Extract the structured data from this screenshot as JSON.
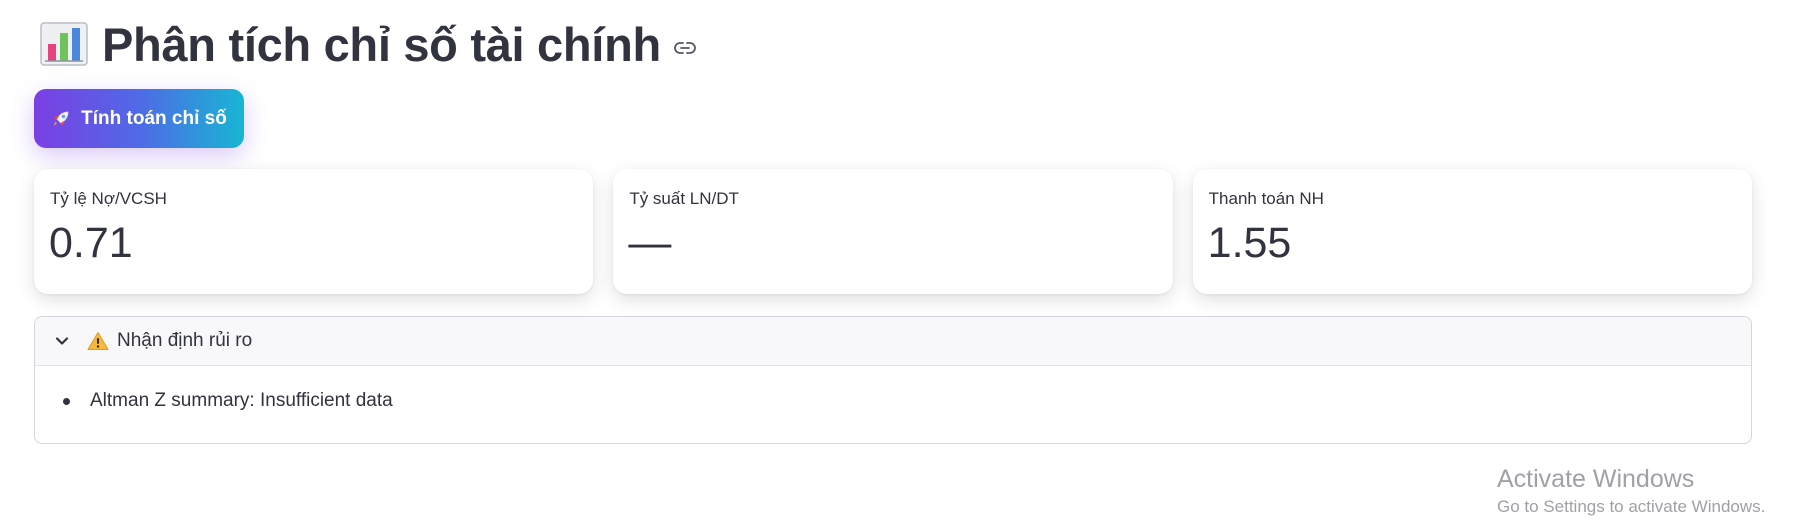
{
  "header": {
    "title": "Phân tích chỉ số tài chính",
    "title_icon": "bar-chart-icon",
    "anchor_icon": "link-icon"
  },
  "toolbar": {
    "calc_button_label": "Tính toán chỉ số",
    "calc_button_icon": "rocket-icon"
  },
  "metrics": [
    {
      "label": "Tỷ lệ Nợ/VCSH",
      "value": "0.71"
    },
    {
      "label": "Tỷ suất LN/DT",
      "value": "—"
    },
    {
      "label": "Thanh toán NH",
      "value": "1.55"
    }
  ],
  "risk_panel": {
    "title": "Nhận định rủi ro",
    "title_icon": "warning-icon",
    "toggle_icon": "chevron-down-icon",
    "expanded": true,
    "items": [
      "Altman Z summary: Insufficient data"
    ]
  },
  "watermark": {
    "title": "Activate Windows",
    "subtitle": "Go to Settings to activate Windows."
  },
  "colors": {
    "text": "#31333f",
    "button_gradient_start": "#7b3fe4",
    "button_gradient_end": "#17b6d4",
    "watermark": "#a0a0a6"
  }
}
